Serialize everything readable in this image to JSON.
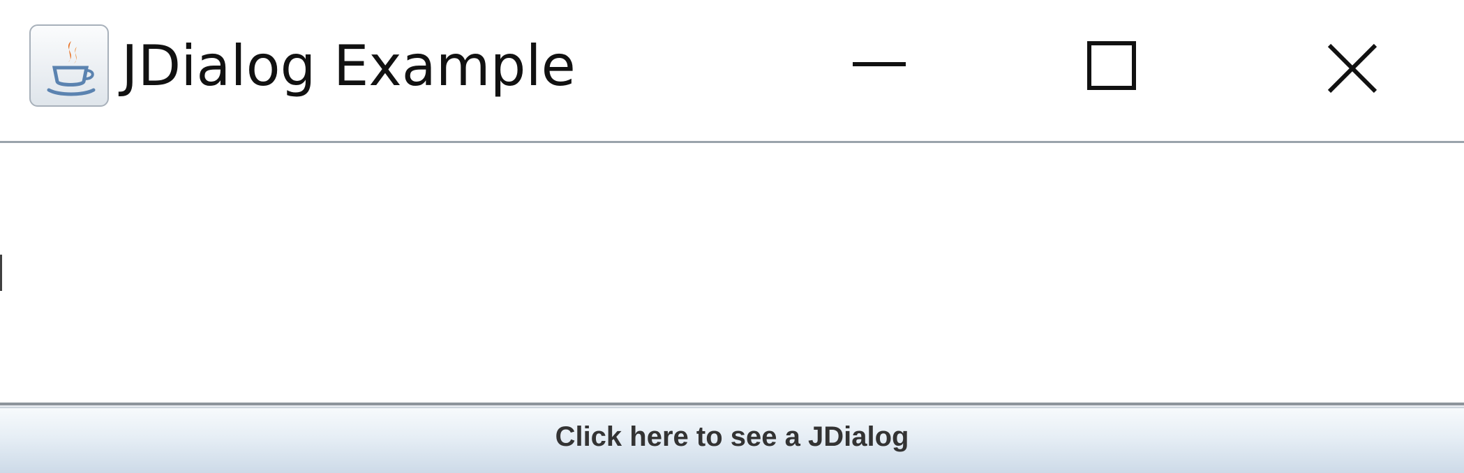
{
  "window": {
    "title": "JDialog Example",
    "icon": "java-coffee-icon",
    "controls": {
      "minimize_icon": "minimize-icon",
      "maximize_icon": "maximize-icon",
      "close_icon": "close-icon"
    }
  },
  "main": {
    "button_label": "Click here to see a JDialog"
  },
  "colors": {
    "title_text": "#111111",
    "button_text": "#333333",
    "button_gradient_top": "#f7fafc",
    "button_gradient_bottom": "#cddae8",
    "java_flame": "#e86c1c",
    "java_cup": "#5b83b0"
  }
}
